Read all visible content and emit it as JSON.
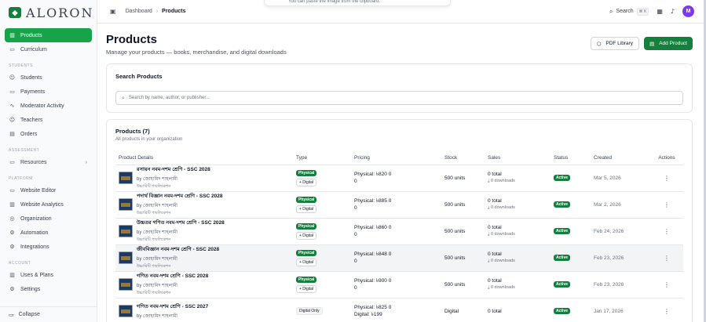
{
  "app": {
    "logo_text": "ALORON",
    "logo_mark": "◆"
  },
  "sidebar": {
    "items_top": [
      {
        "label": "Products",
        "icon": "bar-chart-icon",
        "glyph": "▥",
        "active": true
      },
      {
        "label": "Curriculum",
        "icon": "book-icon",
        "glyph": "▭"
      }
    ],
    "section_students": "STUDENTS",
    "items_students": [
      {
        "label": "Students",
        "icon": "users-icon",
        "glyph": "☺"
      },
      {
        "label": "Payments",
        "icon": "card-icon",
        "glyph": "▭"
      },
      {
        "label": "Moderator Activity",
        "icon": "activity-icon",
        "glyph": "∿"
      },
      {
        "label": "Teachers",
        "icon": "teachers-icon",
        "glyph": "☺"
      },
      {
        "label": "Orders",
        "icon": "cart-icon",
        "glyph": "▤"
      }
    ],
    "section_assessment": "ASSESSMENT",
    "items_assessment": [
      {
        "label": "Resources",
        "icon": "folder-icon",
        "glyph": "▭",
        "chevron": "›"
      }
    ],
    "section_platform": "PLATFORM",
    "items_platform": [
      {
        "label": "Website Editor",
        "icon": "monitor-icon",
        "glyph": "▭"
      },
      {
        "label": "Website Analytics",
        "icon": "chart-icon",
        "glyph": "▥"
      },
      {
        "label": "Organization",
        "icon": "globe-icon",
        "glyph": "◎"
      },
      {
        "label": "Automation",
        "icon": "automation-icon",
        "glyph": "⚙"
      },
      {
        "label": "Integrations",
        "icon": "plug-icon",
        "glyph": "⚙"
      }
    ],
    "section_account": "ACCOUNT",
    "items_account": [
      {
        "label": "Uses & Plans",
        "icon": "plans-icon",
        "glyph": "▥"
      },
      {
        "label": "Settings",
        "icon": "settings-icon",
        "glyph": "⚙"
      }
    ],
    "collapse_label": "Collapse"
  },
  "topbar": {
    "crumb1": "Dashboard",
    "crumb_sep": "›",
    "crumb2": "Products",
    "search_label": "Search",
    "search_kbd": "⌘ K",
    "avatar": "M",
    "popup_text": "You can paste the image from the clipboard."
  },
  "page": {
    "title": "Products",
    "subtitle": "Manage your products — books, merchandise, and digital downloads",
    "pdf_library": "PDF Library",
    "add_product": "Add Product"
  },
  "search_card": {
    "title": "Search Products",
    "placeholder": "Search by name, author, or publisher..."
  },
  "products_card": {
    "title": "Products (7)",
    "subtitle": "All products in your organization",
    "columns": [
      "Product Details",
      "Type",
      "Pricing",
      "Stock",
      "Sales",
      "Status",
      "Created",
      "Actions"
    ],
    "rows": [
      {
        "title": "রসায়ন নবম-দশম শ্রেণি - SSC 2028",
        "author": "by জোহামিদ শাহলামী",
        "publisher": "উচ্চারিটি পাবলিকেশন",
        "type1": "Physical",
        "type2": "+ Digital",
        "price1": "Physical: ৳820 0",
        "price2": "0",
        "stock": "500 units",
        "sales1": "0 total",
        "sales2": "⤓ 0 downloads",
        "status": "Active",
        "created": "Mar 5, 2026",
        "action": "⋮"
      },
      {
        "title": "পদার্থ বিজ্ঞান নবম-দশম শ্রেণি - SSC 2028",
        "author": "by জোহামিদ শাহলামী",
        "publisher": "উচ্চারিটি পাবলিকেশন",
        "type1": "Physical",
        "type2": "+ Digital",
        "price1": "Physical: ৳885 0",
        "price2": "0",
        "stock": "500 units",
        "sales1": "0 total",
        "sales2": "⤓ 0 downloads",
        "status": "Active",
        "created": "Mar 2, 2026",
        "action": "⋮"
      },
      {
        "title": "উচ্চতর গণিত নবম-দশম শ্রেণি - SSC 2028",
        "author": "by জোহামিদ শাহলামী",
        "publisher": "উচ্চারিটি পাবলিকেশন",
        "type1": "Physical",
        "type2": "+ Digital",
        "price1": "Physical: ৳860 0",
        "price2": "0",
        "stock": "500 units",
        "sales1": "0 total",
        "sales2": "⤓ 0 downloads",
        "status": "Active",
        "created": "Feb 24, 2026",
        "action": "⋮"
      },
      {
        "title": "জীববিজ্ঞান নবম-দশম শ্রেণি - SSC 2028",
        "author": "by জোহামিদ শাহলামী",
        "publisher": "উচ্চারিটি পাবলিকেশন",
        "type1": "Physical",
        "type2": "+ Digital",
        "price1": "Physical: ৳848 0",
        "price2": "0",
        "stock": "500 units",
        "sales1": "0 total",
        "sales2": "⤓ 0 downloads",
        "status": "Active",
        "created": "Feb 23, 2026",
        "action": "⋮"
      },
      {
        "title": "গণিত নবম-দশম শ্রেণি - SSC 2028",
        "author": "by জোহামিদ শাহলামী",
        "publisher": "উচ্চারিটি পাবলিকেশন",
        "type1": "Physical",
        "type2": "+ Digital",
        "price1": "Physical: ৳900 0",
        "price2": "0",
        "stock": "500 units",
        "sales1": "0 total",
        "sales2": "⤓ 0 downloads",
        "status": "Active",
        "created": "Feb 23, 2026",
        "action": "⋮"
      },
      {
        "title": "গণিত নবম-দশম শ্রেণি - SSC 2027",
        "author": "by জোহামিদ শাহলামী",
        "publisher": "",
        "type1": "",
        "type2": "",
        "type_only": "Digital Only",
        "price1": "Physical: ৳825 0",
        "price2": "Digital: ৳199",
        "stock": "Digital",
        "sales1": "0 total",
        "sales2": "",
        "status": "Active",
        "created": "Jan 17, 2026",
        "action": "⋮"
      }
    ]
  },
  "colors": {
    "accent": "#15803d",
    "active_nav": "#16a34a",
    "avatar": "#7c3aed"
  }
}
